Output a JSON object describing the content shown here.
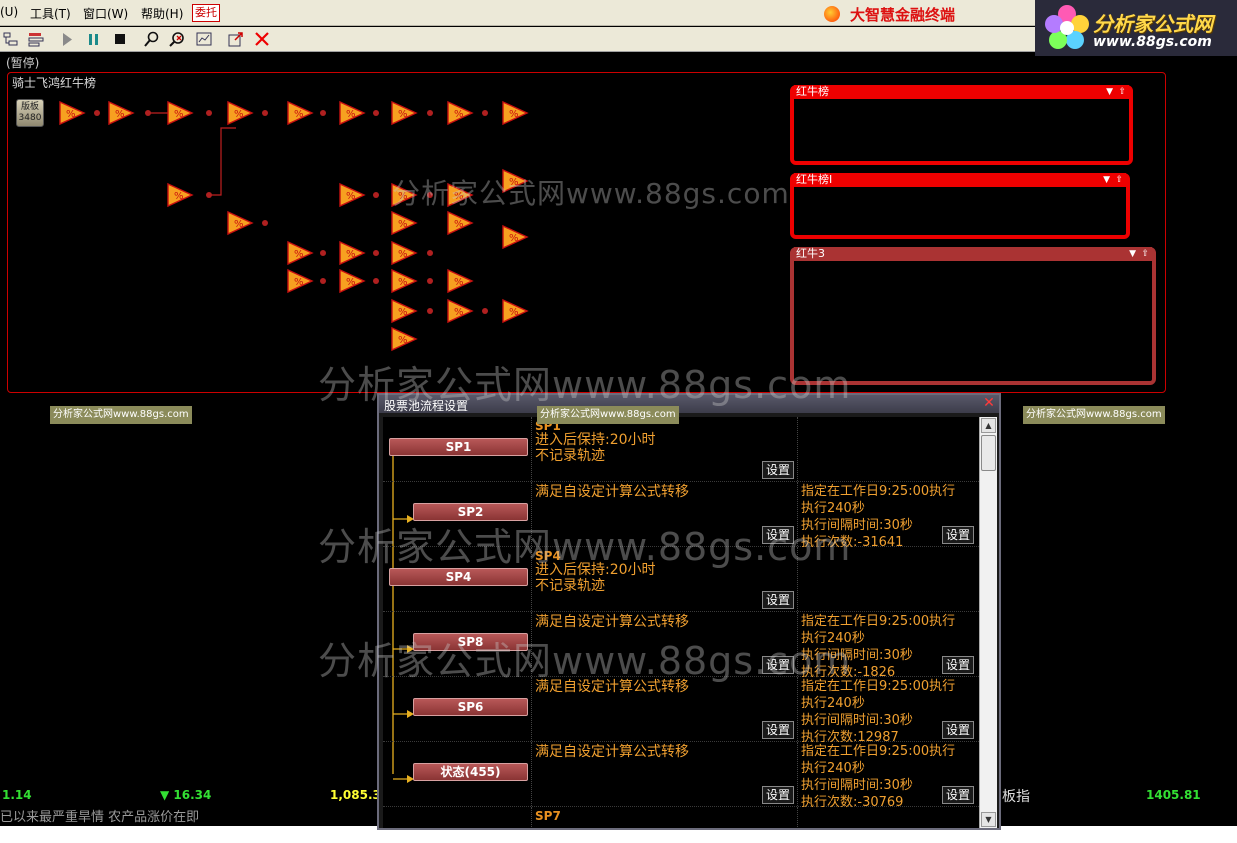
{
  "menu": {
    "items": [
      "(U)",
      "工具(T)",
      "窗口(W)",
      "帮助(H)"
    ],
    "trade": "委托",
    "brand": "大智慧金融终端"
  },
  "watermark": {
    "site_title": "分析家公式网",
    "site_url": "www.88gs.com",
    "big_text": "分析家公式网www.88gs.com",
    "tag_text": "分析家公式网www.88gs.com"
  },
  "main": {
    "pause_label": "(暂停)",
    "flow_title": "骑士飞鸿红牛榜",
    "start_node": {
      "line1": "版板",
      "line2": "3480"
    },
    "node_glyph": "%"
  },
  "lists": [
    {
      "title": "红牛榜"
    },
    {
      "title": "红牛榜I"
    },
    {
      "title": "红牛3"
    }
  ],
  "dialog": {
    "title": "股票池流程设置",
    "set_label": "设置",
    "rows": [
      {
        "node": "SP1",
        "head": "SP1",
        "mid": [
          "进入后保持:20小时",
          "不记录轨迹"
        ],
        "right": []
      },
      {
        "node": "SP2",
        "head": "",
        "mid": [
          "满足自设定计算公式转移"
        ],
        "right": [
          "指定在工作日9:25:00执行",
          "执行240秒",
          "执行间隔时间:30秒",
          "执行次数:-31641"
        ]
      },
      {
        "node": "SP4",
        "head": "SP4",
        "mid": [
          "进入后保持:20小时",
          "不记录轨迹"
        ],
        "right": []
      },
      {
        "node": "SP8",
        "head": "",
        "mid": [
          "满足自设定计算公式转移"
        ],
        "right": [
          "指定在工作日9:25:00执行",
          "执行240秒",
          "执行间隔时间:30秒",
          "执行次数:-1826"
        ]
      },
      {
        "node": "SP6",
        "head": "",
        "mid": [
          "满足自设定计算公式转移"
        ],
        "right": [
          "指定在工作日9:25:00执行",
          "执行240秒",
          "执行间隔时间:30秒",
          "执行次数:12987"
        ]
      },
      {
        "node": "状态(455)",
        "head": "",
        "mid": [
          "满足自设定计算公式转移"
        ],
        "right": [
          "指定在工作日9:25:00执行",
          "执行240秒",
          "执行间隔时间:30秒",
          "执行次数:-30769"
        ]
      },
      {
        "node": "",
        "head": "SP7",
        "mid": [],
        "right": []
      }
    ]
  },
  "status": {
    "v1": "1.14",
    "v2": "▼ 16.34",
    "v3": "1,085.3",
    "idx_label": "板指",
    "v4": "1405.81",
    "news": "已以来最严重旱情 农产品涨价在即"
  },
  "colors": {
    "accent": "#e00000",
    "node_orange": "#f7a020",
    "text_orange": "#f0a030",
    "up_green": "#33e033",
    "yellow": "#ffff33"
  }
}
